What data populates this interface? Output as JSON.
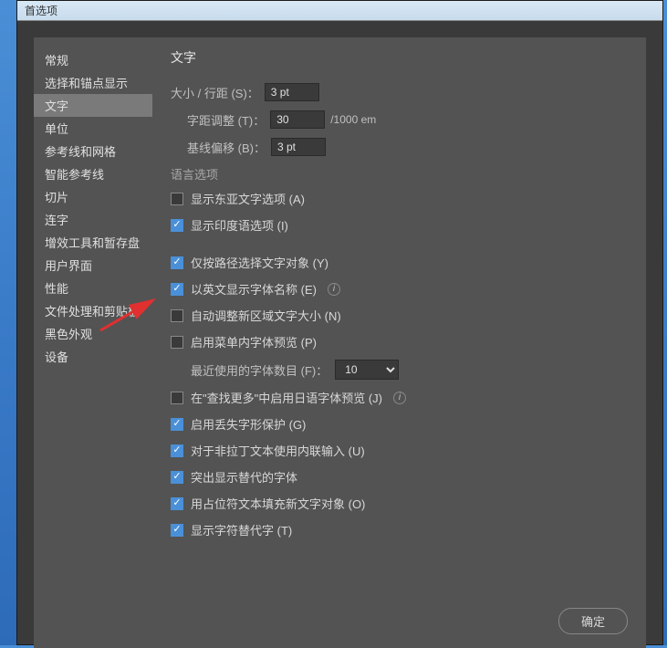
{
  "window": {
    "title": "首选项"
  },
  "sidebar": {
    "items": [
      "常规",
      "选择和锚点显示",
      "文字",
      "单位",
      "参考线和网格",
      "智能参考线",
      "切片",
      "连字",
      "增效工具和暂存盘",
      "用户界面",
      "性能",
      "文件处理和剪贴板",
      "黑色外观",
      "设备"
    ],
    "selected_index": 2
  },
  "main": {
    "title": "文字",
    "fields": {
      "size_leading_label": "大小 / 行距 (S)：",
      "size_leading_value": "3 pt",
      "tracking_label": "字距调整 (T)：",
      "tracking_value": "30",
      "tracking_unit": "/1000 em",
      "baseline_label": "基线偏移 (B)：",
      "baseline_value": "3 pt"
    },
    "lang_group": "语言选项",
    "checkboxes": {
      "east_asian": {
        "label": "显示东亚文字选项 (A)",
        "checked": false
      },
      "indic": {
        "label": "显示印度语选项 (I)",
        "checked": true
      },
      "select_by_path": {
        "label": "仅按路径选择文字对象 (Y)",
        "checked": true
      },
      "english_font_names": {
        "label": "以英文显示字体名称 (E)",
        "checked": true
      },
      "auto_resize": {
        "label": "自动调整新区域文字大小 (N)",
        "checked": false
      },
      "menu_preview": {
        "label": "启用菜单内字体预览 (P)",
        "checked": false
      },
      "jp_preview": {
        "label": "在\"查找更多\"中启用日语字体预览 (J)",
        "checked": false
      },
      "missing_glyph": {
        "label": "启用丢失字形保护 (G)",
        "checked": true
      },
      "inline_input": {
        "label": "对于非拉丁文本使用内联输入 (U)",
        "checked": true
      },
      "highlight_alt": {
        "label": "突出显示替代的字体",
        "checked": true
      },
      "placeholder_text": {
        "label": "用占位符文本填充新文字对象 (O)",
        "checked": true
      },
      "show_alt_glyph": {
        "label": "显示字符替代字 (T)",
        "checked": true
      }
    },
    "recent_fonts": {
      "label": "最近使用的字体数目 (F)：",
      "value": "10"
    }
  },
  "buttons": {
    "ok": "确定"
  }
}
